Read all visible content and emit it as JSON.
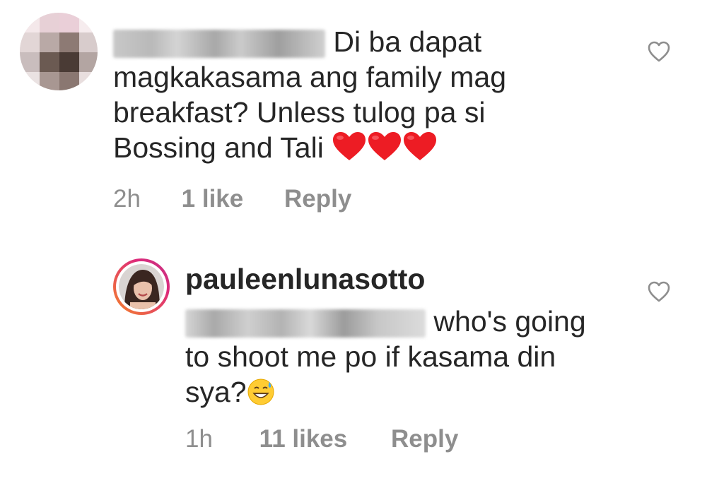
{
  "comments": [
    {
      "text_lines": [
        "Di ba dapat",
        "magkakasama ang family mag",
        "breakfast? Unless tulog pa si",
        "Bossing and Tali"
      ],
      "emoji": "red-heart x3",
      "time": "2h",
      "likes": "1 like",
      "reply_label": "Reply"
    },
    {
      "username": "pauleenlunasotto",
      "text_lines": [
        "who's going",
        "to shoot me po if kasama din",
        "sya?"
      ],
      "emoji": "grinning-face-with-sweat",
      "time": "1h",
      "likes": "11 likes",
      "reply_label": "Reply"
    }
  ],
  "icons": {
    "like": "heart-outline-icon"
  },
  "colors": {
    "text": "#262626",
    "meta": "#8e8e8e",
    "heart": "#ed1c24",
    "story_ring_start": "#f58529",
    "story_ring_end": "#dd2a7b"
  }
}
